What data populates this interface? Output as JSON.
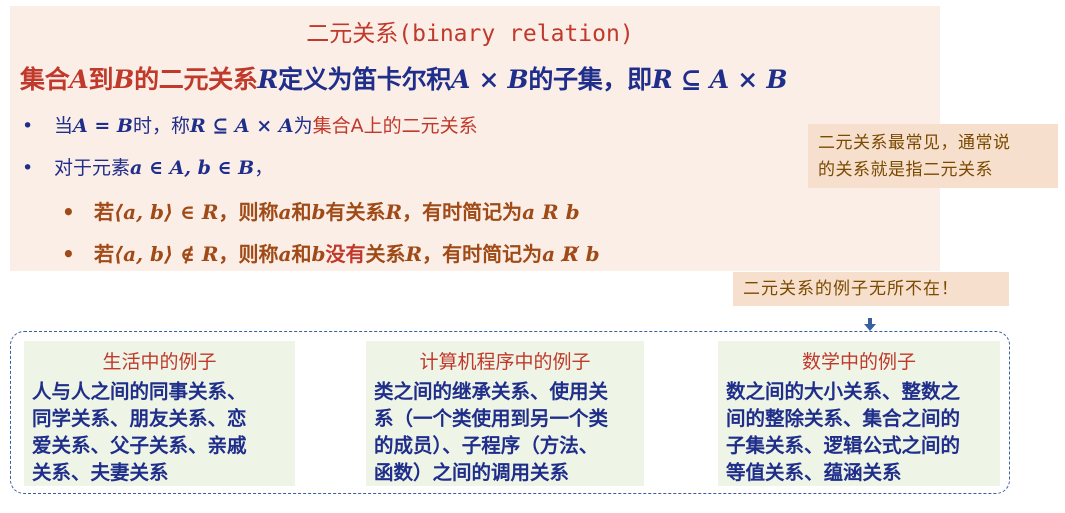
{
  "title": "二元关系(binary relation)",
  "definition": {
    "p1": "集合",
    "A": "A",
    "p2": "到",
    "B": "B",
    "p3": "的二元关系",
    "R": "R",
    "p4": "定义为笛卡尔积",
    "expr1": "A × B",
    "p5": "的子集，即",
    "expr2": "R ⊆ A × B"
  },
  "bullet1": {
    "p1": "当",
    "eq": "A = B",
    "p2": "时，称",
    "expr": "R ⊆ A × A",
    "p3": "为",
    "highlight": "集合A上的二元关系"
  },
  "bullet2": {
    "p1": "对于元素",
    "expr": "a ∈ A, b ∈ B",
    "p2": "，"
  },
  "sub1": {
    "p1": "若",
    "expr": "⟨a, b⟩ ∈ R",
    "p2": "，则称",
    "a": "a",
    "p3": "和",
    "b": "b",
    "p4": "有关系",
    "R": "R",
    "p5": "，有时简记为",
    "short": "a R b"
  },
  "sub2": {
    "p1": "若",
    "expr": "⟨a, b⟩ ∉ R",
    "p2": "，则称",
    "a": "a",
    "p3": "和",
    "b": "b",
    "neg": "没有",
    "p4": "关系",
    "R": "R",
    "p5": "，有时简记为",
    "short": "a R̸ b"
  },
  "note_common": {
    "line1": "二元关系最常见，通常说",
    "line2": "的关系就是指二元关系"
  },
  "note_everywhere": "二元关系的例子无所不在！",
  "examples": [
    {
      "title": "生活中的例子",
      "lines": [
        "人与人之间的同事关系、",
        "同学关系、朋友关系、恋",
        "爱关系、父子关系、亲戚",
        "关系、夫妻关系"
      ]
    },
    {
      "title": "计算机程序中的例子",
      "lines": [
        "类之间的继承关系、使用关",
        "系（一个类使用到另一个类",
        "的成员）、子程序（方法、",
        "函数）之间的调用关系"
      ]
    },
    {
      "title": "数学中的例子",
      "lines": [
        "数之间的大小关系、整数之",
        "间的整除关系、集合之间的",
        "子集关系、逻辑公式之间的",
        "等值关系、蕴涵关系"
      ]
    }
  ],
  "colors": {
    "definition_bg": "#fbeee6",
    "note_bg": "#f6dfcd",
    "card_bg": "#eef4e6",
    "accent_red": "#c0392b",
    "navy": "#1f2e8a",
    "brown": "#a04a17"
  },
  "icons": {
    "bullet": "•",
    "arrow": "down-arrow-icon"
  }
}
